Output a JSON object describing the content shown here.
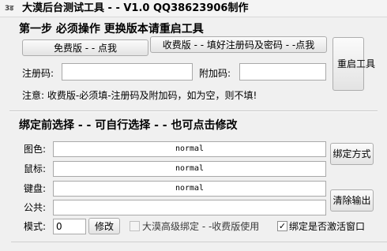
{
  "window": {
    "icon_text": "3ड",
    "title": "大漠后台测试工具 - - V1.0  QQ38623906制作"
  },
  "step1": {
    "heading": "第一步  必须操作   更换版本请重启工具",
    "free_button": "免费版 - - 点我",
    "paid_button": "收费版 - - 填好注册码及密码 - -点我",
    "restart_button": "重启工具",
    "reg_code_label": "注册码:",
    "reg_code_value": "",
    "extra_code_label": "附加码:",
    "extra_code_value": "",
    "note": "注意: 收费版-必须填-注册码及附加码，如为空，则不填!"
  },
  "step2": {
    "heading": "绑定前选择 - - 可自行选择 - - 也可点击修改",
    "display_label": "图色:",
    "display_value": "normal",
    "mouse_label": "鼠标:",
    "mouse_value": "normal",
    "keyboard_label": "键盘:",
    "keyboard_value": "normal",
    "public_label": "公共:",
    "public_value": "",
    "mode_label": "模式:",
    "mode_value": "0",
    "modify_button": "修改",
    "bind_mode_button": "绑定方式",
    "clear_output_button": "清除输出",
    "advanced_bind_label": "大漠高级绑定 - -收费版使用",
    "advanced_bind_checked": false,
    "activate_window_label": "绑定是否激活窗口",
    "activate_window_checked": true
  }
}
